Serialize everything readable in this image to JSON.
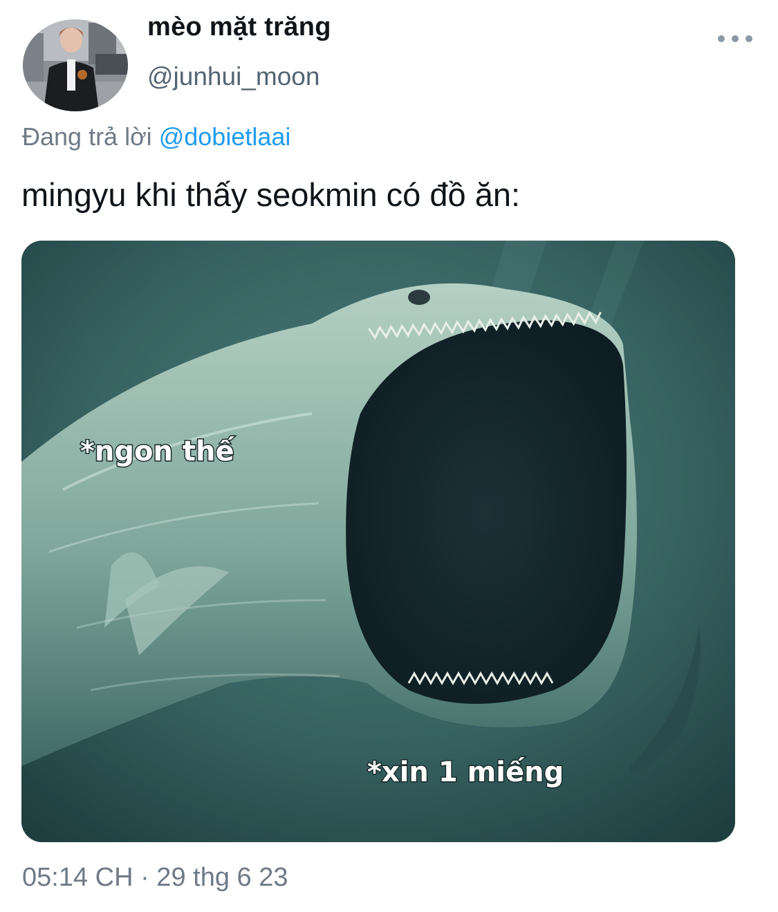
{
  "author": {
    "display_name": "mèo mặt trăng",
    "handle": "@junhui_moon"
  },
  "reply": {
    "prefix": "Đang trả lời",
    "mention": "@dobietlaai"
  },
  "tweet": {
    "text": "mingyu khi thấy seokmin có đồ ăn:",
    "timestamp": "05:14 CH · 29 thg 6 23"
  },
  "media": {
    "caption_left": "*ngon thế",
    "caption_right": "*xin 1 miếng"
  },
  "icons": {
    "more": "more-horizontal-icon"
  },
  "colors": {
    "text": "#0f1419",
    "secondary": "#536471",
    "link": "#1d9bf0",
    "water": "#3b6565"
  }
}
